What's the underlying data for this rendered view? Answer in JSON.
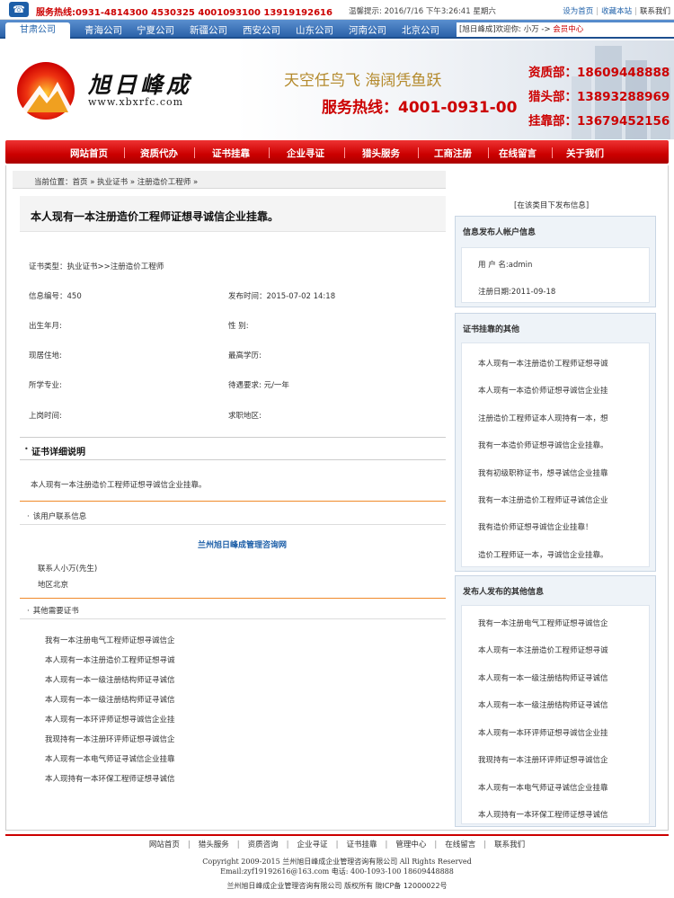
{
  "topbar": {
    "hotline": "服务热线:0931-4814300  4530325  4001093100  13919192616",
    "tip": "温馨提示: 2016/7/16 下午3:26:41 星期六",
    "links": [
      "设为首页",
      "收藏本站",
      "联系我们"
    ]
  },
  "provinces": {
    "current": "甘肃公司",
    "items": [
      "青海公司",
      "宁夏公司",
      "新疆公司",
      "西安公司",
      "山东公司",
      "河南公司",
      "北京公司"
    ],
    "user_text": "[旭日峰成]欢迎你:  小万 -> ",
    "member_link": "会员中心"
  },
  "banner": {
    "logo_text": "旭日峰成",
    "logo_url": "www.xbxrfc.com",
    "slogan": "天空任鸟飞 海阔凭鱼跃",
    "service": "服务热线：4001-0931-00",
    "contacts": [
      "资质部：18609448888",
      "猎头部：13893288969",
      "挂靠部：13679452156"
    ]
  },
  "mainnav": [
    "网站首页",
    "资质代办",
    "证书挂靠",
    "企业寻证",
    "猎头服务",
    "工商注册",
    "在线留言",
    "关于我们"
  ],
  "breadcrumb": {
    "label": "当前位置：",
    "items": [
      "首页",
      "执业证书",
      "注册造价工程师"
    ]
  },
  "detail": {
    "title": "本人现有一本注册造价工程师证想寻诚信企业挂靠。",
    "cert_type": "证书类型：执业证书>>注册造价工程师",
    "info_no": "信息编号：450",
    "publish_time": "发布时间：2015-07-02 14:18",
    "birth": "出生年月:",
    "gender": "性  别:",
    "residence": "现居住地:",
    "education": "最高学历:",
    "major": "所学专业:",
    "salary": "待遇要求:  元/一年",
    "work_time": "上岗时间:",
    "area": "求职地区:"
  },
  "sections": {
    "cert_detail": "证书详细说明",
    "description": "本人现有一本注册造价工程师证想寻诚信企业挂靠。",
    "contact_head": "该用户联系信息",
    "company": "兰州旭日峰成管理咨询网",
    "contact_person": "联系人小万(先生)",
    "contact_area": "地区北京",
    "other_head": "其他需要证书"
  },
  "other_certs": [
    "我有一本注册电气工程师证想寻诚信企",
    "本人现有一本注册造价工程师证想寻诚",
    "本人现有一本一级注册结构师证寻诚信",
    "本人现有一本一级注册结构师证寻诚信",
    "本人现有一本环评师证想寻诚信企业挂",
    "我现持有一本注册环评师证想寻诚信企",
    "本人现有一本电气师证寻诚信企业挂靠",
    "本人现持有一本环保工程师证想寻诚信"
  ],
  "sidebar": {
    "top_link": "[在该类目下发布信息]",
    "account_title": "信息发布人帐户信息",
    "account": [
      "用 户 名:admin",
      "注册日期:2011-09-18"
    ],
    "cert_title": "证书挂靠的其他",
    "cert_items": [
      "本人现有一本注册造价工程师证想寻诚",
      "本人现有一本造价师证想寻诚信企业挂",
      "注册造价工程师证本人现持有一本，想",
      "我有一本造价师证想寻诚信企业挂靠。",
      "我有初级职称证书，想寻诚信企业挂靠",
      "我有一本注册造价工程师证寻诚信企业",
      "我有造价师证想寻诚信企业挂靠！",
      "造价工程师证一本，寻诚信企业挂靠。"
    ],
    "publisher_title": "发布人发布的其他信息",
    "publisher_items": [
      "我有一本注册电气工程师证想寻诚信企",
      "本人现有一本注册造价工程师证想寻诚",
      "本人现有一本一级注册结构师证寻诚信",
      "本人现有一本一级注册结构师证寻诚信",
      "本人现有一本环评师证想寻诚信企业挂",
      "我现持有一本注册环评师证想寻诚信企",
      "本人现有一本电气师证寻诚信企业挂靠",
      "本人现持有一本环保工程师证想寻诚信"
    ]
  },
  "footer": {
    "nav": [
      "网站首页",
      "猎头服务",
      "资质咨询",
      "企业寻证",
      "证书挂靠",
      "管理中心",
      "在线留言",
      "联系我们"
    ],
    "copyright": "Copyright 2009-2015 兰州旭日峰成企业管理咨询有限公司 All Rights Reserved",
    "email": "Email:zyf19192616@163.com 电话: 400-1093-100 18609448888",
    "icp": "兰州旭日峰成企业管理咨询有限公司 版权所有  陇ICP备 12000022号"
  },
  "colors": {
    "brand_red": "#cc0000",
    "nav_blue": "#2b62a9",
    "accent_orange": "#f08a2a"
  }
}
